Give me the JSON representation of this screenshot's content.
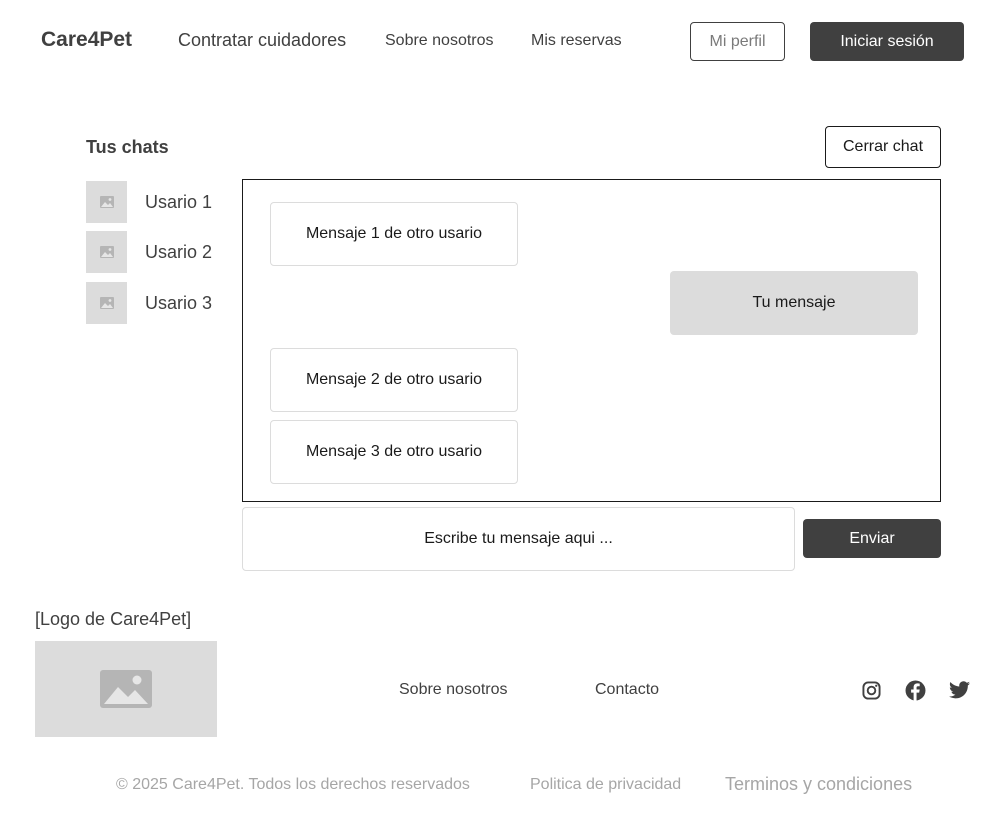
{
  "header": {
    "brand": "Care4Pet",
    "nav": [
      "Contratar cuidadores",
      "Sobre nosotros",
      "Mis reservas"
    ],
    "profile_button": "Mi perfil",
    "login_button": "Iniciar sesión"
  },
  "chats": {
    "title": "Tus chats",
    "close_button": "Cerrar chat",
    "users": [
      {
        "name": "Usario 1",
        "icon": "image-placeholder-icon"
      },
      {
        "name": "Usario 2",
        "icon": "image-placeholder-icon"
      },
      {
        "name": "Usario 3",
        "icon": "image-placeholder-icon"
      }
    ],
    "messages": [
      {
        "from": "other",
        "text": "Mensaje 1 de otro usario"
      },
      {
        "from": "me",
        "text": "Tu mensaje"
      },
      {
        "from": "other",
        "text": "Mensaje 2 de otro usario"
      },
      {
        "from": "other",
        "text": "Mensaje 3 de otro usario"
      }
    ],
    "input_placeholder": "Escribe tu mensaje aqui ...",
    "send_button": "Enviar"
  },
  "footer": {
    "logo_label": "[Logo de Care4Pet]",
    "links": [
      "Sobre nosotros",
      "Contacto"
    ],
    "social": [
      "instagram-icon",
      "facebook-icon",
      "twitter-icon"
    ],
    "copyright": "© 2025 Care4Pet. Todos los derechos reservados",
    "privacy": "Politica de privacidad",
    "terms": "Terminos y condiciones"
  },
  "colors": {
    "dark": "#404040",
    "placeholder_gray": "#dcdcdc",
    "muted_text": "#a6a6a6"
  }
}
